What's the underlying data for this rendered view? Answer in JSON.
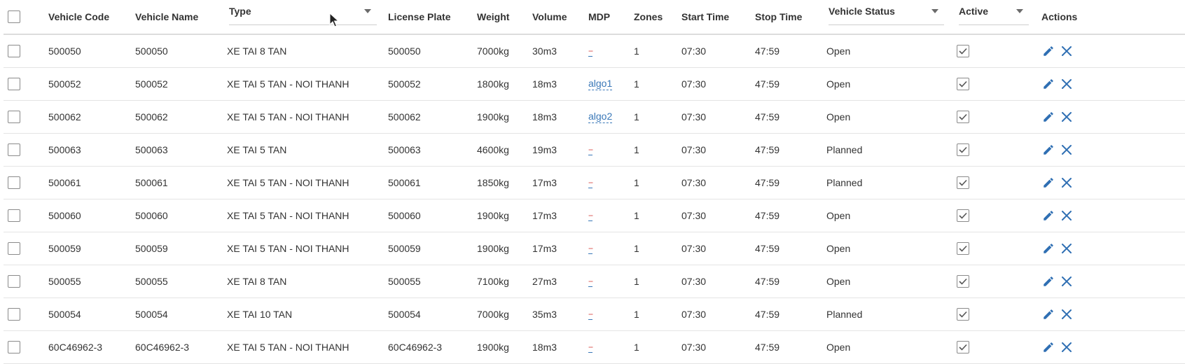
{
  "colors": {
    "accent": "#2f6fb3",
    "mdp_placeholder": "#d9534f"
  },
  "header": {
    "vehicle_code": "Vehicle Code",
    "vehicle_name": "Vehicle Name",
    "type": "Type",
    "license_plate": "License Plate",
    "weight": "Weight",
    "volume": "Volume",
    "mdp": "MDP",
    "zones": "Zones",
    "start_time": "Start Time",
    "stop_time": "Stop Time",
    "vehicle_status": "Vehicle Status",
    "active": "Active",
    "actions": "Actions"
  },
  "icons": {
    "edit": "pencil-icon",
    "delete": "close-icon",
    "active": "check-icon",
    "filter": "caret-down-icon"
  },
  "rows": [
    {
      "code": "500050",
      "name": "500050",
      "type": "XE TAI 8 TAN",
      "plate": "500050",
      "weight": "7000kg",
      "volume": "30m3",
      "mdp": "--",
      "zones": "1",
      "start": "07:30",
      "stop": "47:59",
      "status": "Open",
      "active": true
    },
    {
      "code": "500052",
      "name": "500052",
      "type": "XE TAI 5 TAN - NOI THANH",
      "plate": "500052",
      "weight": "1800kg",
      "volume": "18m3",
      "mdp": "algo1",
      "zones": "1",
      "start": "07:30",
      "stop": "47:59",
      "status": "Open",
      "active": true
    },
    {
      "code": "500062",
      "name": "500062",
      "type": "XE TAI 5 TAN - NOI THANH",
      "plate": "500062",
      "weight": "1900kg",
      "volume": "18m3",
      "mdp": "algo2",
      "zones": "1",
      "start": "07:30",
      "stop": "47:59",
      "status": "Open",
      "active": true
    },
    {
      "code": "500063",
      "name": "500063",
      "type": "XE TAI 5 TAN",
      "plate": "500063",
      "weight": "4600kg",
      "volume": "19m3",
      "mdp": "--",
      "zones": "1",
      "start": "07:30",
      "stop": "47:59",
      "status": "Planned",
      "active": true
    },
    {
      "code": "500061",
      "name": "500061",
      "type": "XE TAI 5 TAN - NOI THANH",
      "plate": "500061",
      "weight": "1850kg",
      "volume": "17m3",
      "mdp": "--",
      "zones": "1",
      "start": "07:30",
      "stop": "47:59",
      "status": "Planned",
      "active": true
    },
    {
      "code": "500060",
      "name": "500060",
      "type": "XE TAI 5 TAN - NOI THANH",
      "plate": "500060",
      "weight": "1900kg",
      "volume": "17m3",
      "mdp": "--",
      "zones": "1",
      "start": "07:30",
      "stop": "47:59",
      "status": "Open",
      "active": true
    },
    {
      "code": "500059",
      "name": "500059",
      "type": "XE TAI 5 TAN - NOI THANH",
      "plate": "500059",
      "weight": "1900kg",
      "volume": "17m3",
      "mdp": "--",
      "zones": "1",
      "start": "07:30",
      "stop": "47:59",
      "status": "Open",
      "active": true
    },
    {
      "code": "500055",
      "name": "500055",
      "type": "XE TAI 8 TAN",
      "plate": "500055",
      "weight": "7100kg",
      "volume": "27m3",
      "mdp": "--",
      "zones": "1",
      "start": "07:30",
      "stop": "47:59",
      "status": "Open",
      "active": true
    },
    {
      "code": "500054",
      "name": "500054",
      "type": "XE TAI 10 TAN",
      "plate": "500054",
      "weight": "7000kg",
      "volume": "35m3",
      "mdp": "--",
      "zones": "1",
      "start": "07:30",
      "stop": "47:59",
      "status": "Planned",
      "active": true
    },
    {
      "code": "60C46962-3",
      "name": "60C46962-3",
      "type": "XE TAI 5 TAN - NOI THANH",
      "plate": "60C46962-3",
      "weight": "1900kg",
      "volume": "18m3",
      "mdp": "--",
      "zones": "1",
      "start": "07:30",
      "stop": "47:59",
      "status": "Open",
      "active": true
    }
  ]
}
